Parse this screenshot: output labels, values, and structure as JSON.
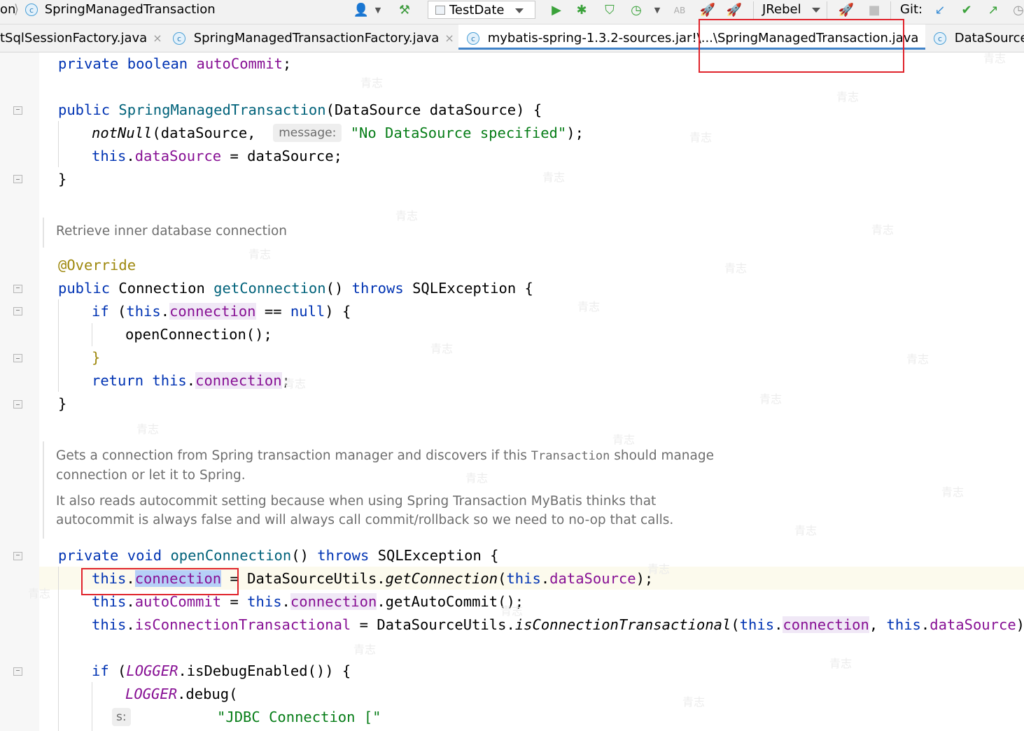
{
  "toolbar": {
    "breadcrumb_prefix": "on",
    "breadcrumb_class": "SpringManagedTransaction",
    "run_config": "TestDate",
    "jrebel_label": "JRebel",
    "git_label": "Git:"
  },
  "tabs": [
    {
      "label": "tSqlSessionFactory.java",
      "close": "×"
    },
    {
      "label": "SpringManagedTransactionFactory.java",
      "close": "×"
    },
    {
      "label": "mybatis-spring-1.3.2-sources.jar!\\...\\SpringManagedTransaction.java",
      "close": "×"
    },
    {
      "label": "DataSource",
      "close": ""
    }
  ],
  "code": {
    "l1": {
      "kw": "private boolean ",
      "fld": "autoCommit",
      "end": ";"
    },
    "l2": {
      "kw": "public ",
      "fn": "SpringManagedTransaction",
      "rest": "(DataSource dataSource) {"
    },
    "l3": {
      "fn": "notNull",
      "a": "(dataSource,  ",
      "hint": "message:",
      "str": "\"No DataSource specified\"",
      "end": ");"
    },
    "l4": {
      "kw": "this",
      "dot": ".",
      "fld": "dataSource",
      "rest": " = dataSource;"
    },
    "l5": "}",
    "doc1": "Retrieve inner database connection",
    "l6": "@Override",
    "l7": {
      "kw": "public ",
      "type": "Connection ",
      "fn": "getConnection",
      "p": "() ",
      "kw2": "throws ",
      "rest": "SQLException {"
    },
    "l8": {
      "kw": "if ",
      "p": "(",
      "kw2": "this",
      "dot": ".",
      "fld": "connection",
      "op": " == ",
      "kw3": "null",
      "rest": ") {"
    },
    "l9": "openConnection();",
    "l10": "}",
    "l11": {
      "kw": "return ",
      "kw2": "this",
      "dot": ".",
      "fld": "connection",
      "end": ";"
    },
    "l12": "}",
    "doc2a": "Gets a connection from Spring transaction manager and discovers if this",
    "doc2code": "Transaction",
    "doc2b": " should manage",
    "doc2c": "connection or let it to Spring.",
    "doc3a": "It also reads autocommit setting because when using Spring Transaction MyBatis thinks that",
    "doc3b": "autocommit is always false and will always call commit/rollback so we need to no-op that calls.",
    "l13": {
      "kw": "private void ",
      "fn": "openConnection",
      "p": "() ",
      "kw2": "throws ",
      "rest": "SQLException {"
    },
    "l14": {
      "kw": "this",
      "dot": ".",
      "fld": "connection",
      "op": " = ",
      "cls": "DataSourceUtils.",
      "fn": "getConnection",
      "p": "(",
      "kw2": "this",
      "dot2": ".",
      "fld2": "dataSource",
      "end": ");"
    },
    "l15": {
      "kw": "this",
      "dot": ".",
      "fld": "autoCommit",
      "op": " = ",
      "kw2": "this",
      "dot2": ".",
      "fld2": "connection",
      "rest": ".getAutoCommit();"
    },
    "l16": {
      "kw": "this",
      "dot": ".",
      "fld": "isConnectionTransactional",
      "op": " = ",
      "cls": "DataSourceUtils.",
      "fn": "isConnectionTransactional",
      "p": "(",
      "kw2": "this",
      "dot2": ".",
      "fld2": "connection",
      "sep": ", ",
      "kw3": "this",
      "dot3": ".",
      "fld3": "dataSource",
      "end": ");"
    },
    "l17": {
      "kw": "if ",
      "p": "(",
      "fld": "LOGGER",
      "rest": ".isDebugEnabled()) {"
    },
    "l18": {
      "fld": "LOGGER",
      "rest": ".debug("
    },
    "l19": {
      "hint": "s:",
      "str": "\"JDBC Connection [\""
    }
  },
  "watermark": "青志"
}
